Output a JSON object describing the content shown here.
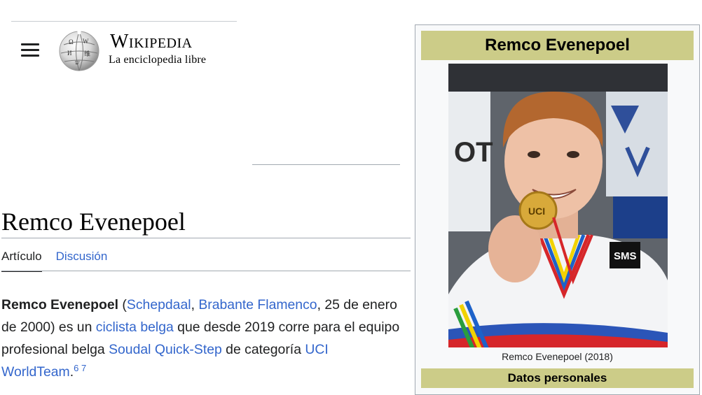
{
  "header": {
    "wordmark": "Wikipedia",
    "tagline": "La enciclopedia libre",
    "menu_icon": "hamburger-menu-icon",
    "logo_icon": "wikipedia-globe-logo"
  },
  "article": {
    "title": "Remco Evenepoel",
    "tabs": [
      {
        "label": "Artículo",
        "active": true
      },
      {
        "label": "Discusión",
        "active": false
      }
    ],
    "lead": {
      "subject": "Remco Evenepoel",
      "open_paren": " (",
      "link_place": "Schepdaal",
      "comma1": ", ",
      "link_region": "Brabante Flamenco",
      "birth": ", 25 de enero de 2000) es un ",
      "link_cyclist": "ciclista belga",
      "mid": " que desde 2019 corre para el equipo profesional belga ",
      "link_team": "Soudal Quick-Step",
      "mid2": " de categoría ",
      "link_category": "UCI WorldTeam",
      "period": ".",
      "ref1": "6",
      "ref2": "7"
    }
  },
  "infobox": {
    "title": "Remco Evenepoel",
    "image_caption": "Remco Evenepoel (2018)",
    "section_personal": "Datos personales",
    "title_bg": "#cccc88"
  },
  "colors": {
    "link": "#3366cc",
    "text": "#202122",
    "border": "#a2a9b1"
  }
}
